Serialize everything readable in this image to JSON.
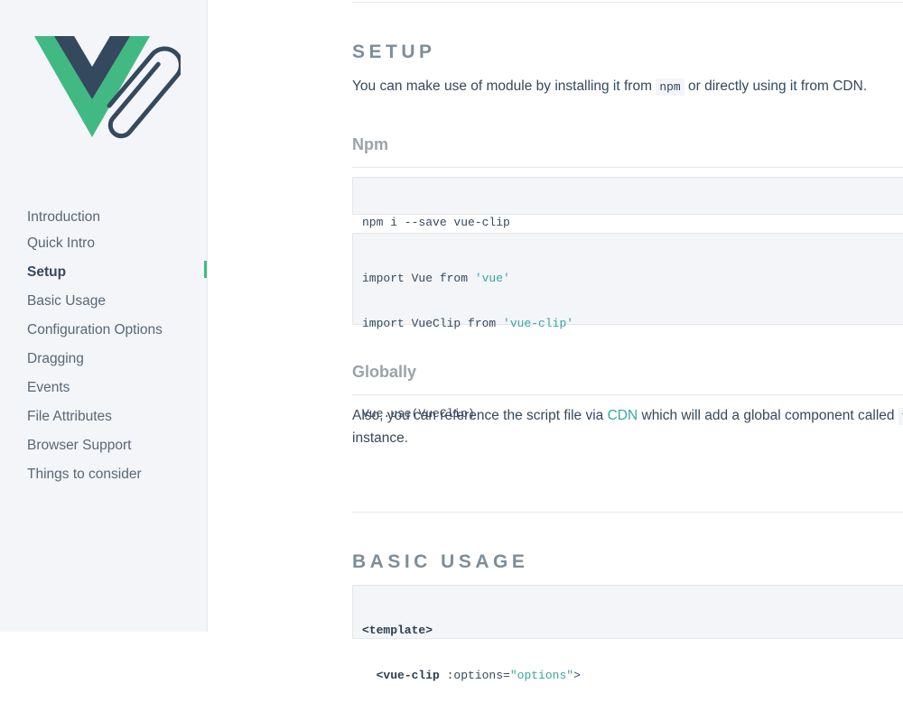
{
  "sidebar": {
    "logo_icon": "vue-clip-logo-icon",
    "colors": {
      "green": "#42b983",
      "dark": "#35495e",
      "accent": "#42b983"
    },
    "items": [
      {
        "label": "Introduction"
      },
      {
        "label": "Quick Intro"
      },
      {
        "label": "Setup",
        "active": true
      },
      {
        "label": "Basic Usage"
      },
      {
        "label": "Configuration Options"
      },
      {
        "label": "Dragging"
      },
      {
        "label": "Events"
      },
      {
        "label": "File Attributes"
      },
      {
        "label": "Browser Support"
      },
      {
        "label": "Things to consider"
      }
    ]
  },
  "setup": {
    "title": "SETUP",
    "intro_before": "You can make use of module by installing it from ",
    "intro_code": "npm",
    "intro_after": " or directly using it from CDN.",
    "npm_title": "Npm",
    "install_cmd": "npm i --save vue-clip",
    "import1_prefix": "import Vue from ",
    "import1_str": "'vue'",
    "import2_prefix": "import VueClip from ",
    "import2_str": "'vue-clip'",
    "use_line": "Vue.use(VueClip)",
    "globally_title": "Globally",
    "global_before": "Also, you can reference the script file via ",
    "global_link": "CDN",
    "global_after": " which will add a global component called ",
    "global_cut": "v",
    "global_line2": "instance."
  },
  "basic_usage": {
    "title": "BASIC USAGE",
    "line1": "<template>",
    "line2_tag": "<vue-clip",
    "line2_attr": " :options=",
    "line2_str": "\"options\"",
    "line2_end": ">"
  }
}
